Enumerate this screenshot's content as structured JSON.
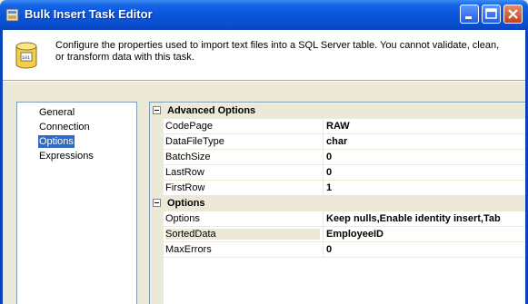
{
  "window": {
    "title": "Bulk Insert Task Editor",
    "header_description": "Configure the properties used to import text files into a SQL Server table. You cannot validate, clean, or transform data with this task."
  },
  "nav": {
    "items": [
      {
        "label": "General",
        "selected": false
      },
      {
        "label": "Connection",
        "selected": false
      },
      {
        "label": "Options",
        "selected": true
      },
      {
        "label": "Expressions",
        "selected": false
      }
    ]
  },
  "properties": {
    "categories": [
      {
        "name": "Advanced Options",
        "rows": [
          {
            "name": "CodePage",
            "value": "RAW"
          },
          {
            "name": "DataFileType",
            "value": "char"
          },
          {
            "name": "BatchSize",
            "value": "0"
          },
          {
            "name": "LastRow",
            "value": "0"
          },
          {
            "name": "FirstRow",
            "value": "1"
          }
        ]
      },
      {
        "name": "Options",
        "rows": [
          {
            "name": "Options",
            "value": "Keep nulls,Enable identity insert,Tab"
          },
          {
            "name": "SortedData",
            "value": "EmployeeID"
          },
          {
            "name": "MaxErrors",
            "value": "0"
          }
        ]
      }
    ]
  },
  "icons": {
    "app": "task-icon",
    "header": "database-icon",
    "minimize": "minimize-icon",
    "maximize": "maximize-icon",
    "close": "close-icon"
  },
  "colors": {
    "titlebar": "#0a55dc",
    "selection": "#316ac5",
    "window_bg": "#ece9d8"
  }
}
